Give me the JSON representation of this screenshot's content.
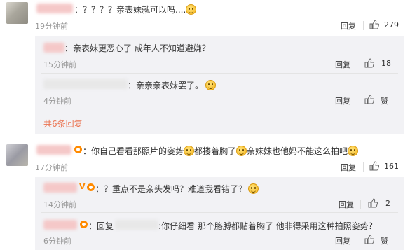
{
  "comments": [
    {
      "text": "：？？？？亲表妹就可以吗....",
      "time": "19分钟前",
      "reply_label": "回复",
      "like_count": "279",
      "replies": [
        {
          "text": "：亲表妹更恶心了 成年人不知道避嫌？",
          "time": "15分钟前",
          "reply_label": "回复",
          "like_count": "18"
        },
        {
          "text": "：亲亲亲表妹罢了。",
          "time": "4分钟前",
          "reply_label": "回复",
          "like_count": "赞"
        }
      ],
      "more_replies": "共6条回复"
    },
    {
      "text_a": "：你自己看看那照片的姿势",
      "text_b": "都搂着胸了",
      "text_c": "亲妹妹也他妈不能这么拍吧",
      "time": "17分钟前",
      "reply_label": "回复",
      "like_count": "161",
      "replies": [
        {
          "badge": "V",
          "text": "：？重点不是亲头发吗？难道我看错了？",
          "time": "14分钟前",
          "reply_label": "回复",
          "like_count": "2"
        },
        {
          "text_prefix": "：回复",
          "text": ":你仔细看 那个胳膊都贴着胸了 他非得采用这种拍照姿势？",
          "time": "6分钟前",
          "reply_label": "回复",
          "like_count": "赞"
        }
      ]
    }
  ],
  "icons": {
    "like": "thumbs-up-icon",
    "emoji": "smiley-emoji-icon",
    "badge": "member-badge-icon"
  },
  "colors": {
    "link": "#eb7350",
    "reply_bg": "#f2f2f5",
    "time": "#999999",
    "vip": "#ff8a00"
  }
}
